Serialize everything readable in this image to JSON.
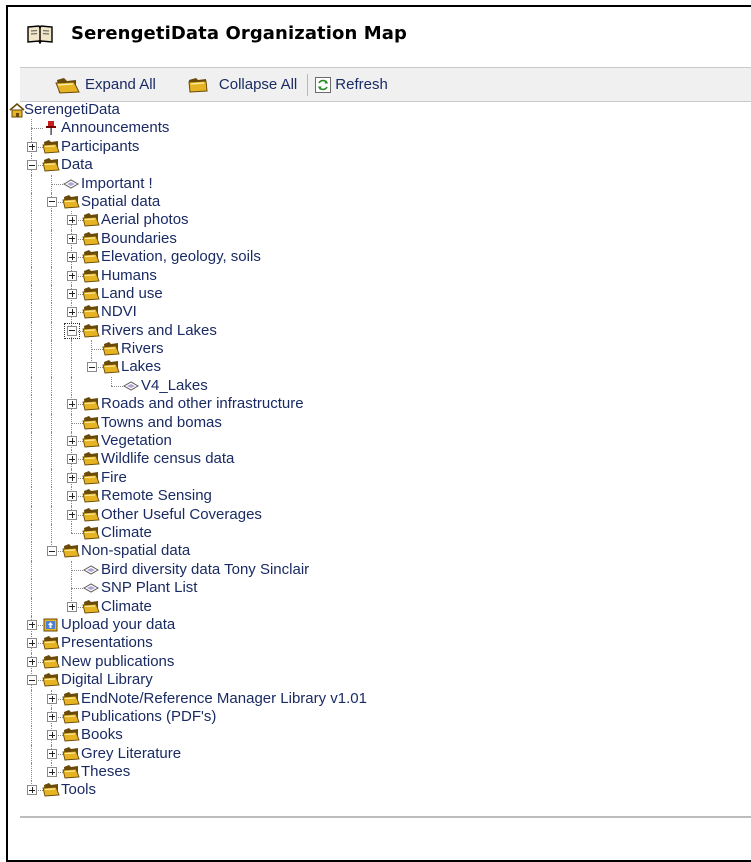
{
  "window": {
    "title": "SerengetiData Organization Map"
  },
  "toolbar": {
    "expand_all": "Expand All",
    "collapse_all": "Collapse All",
    "refresh": "Refresh"
  },
  "tree": [
    {
      "label": "SerengetiData",
      "depth": 0,
      "icon": "home",
      "state": "root"
    },
    {
      "label": "Announcements",
      "depth": 1,
      "icon": "pin",
      "state": "leaf"
    },
    {
      "label": "Participants",
      "depth": 1,
      "icon": "folder",
      "state": "collapsed"
    },
    {
      "label": "Data",
      "depth": 1,
      "icon": "folder",
      "state": "expanded"
    },
    {
      "label": "Important !",
      "depth": 2,
      "icon": "doc",
      "state": "leaf"
    },
    {
      "label": "Spatial data",
      "depth": 2,
      "icon": "folder",
      "state": "expanded"
    },
    {
      "label": "Aerial photos",
      "depth": 3,
      "icon": "folder",
      "state": "collapsed"
    },
    {
      "label": "Boundaries",
      "depth": 3,
      "icon": "folder",
      "state": "collapsed"
    },
    {
      "label": "Elevation, geology, soils",
      "depth": 3,
      "icon": "folder",
      "state": "collapsed"
    },
    {
      "label": "Humans",
      "depth": 3,
      "icon": "folder",
      "state": "collapsed"
    },
    {
      "label": "Land use",
      "depth": 3,
      "icon": "folder",
      "state": "collapsed"
    },
    {
      "label": "NDVI",
      "depth": 3,
      "icon": "folder",
      "state": "collapsed"
    },
    {
      "label": "Rivers and Lakes",
      "depth": 3,
      "icon": "folder",
      "state": "expanded",
      "focused": true
    },
    {
      "label": "Rivers",
      "depth": 4,
      "icon": "folder",
      "state": "leaf"
    },
    {
      "label": "Lakes",
      "depth": 4,
      "icon": "folder",
      "state": "expanded"
    },
    {
      "label": "V4_Lakes",
      "depth": 5,
      "icon": "doc",
      "state": "leaf"
    },
    {
      "label": "Roads and other infrastructure",
      "depth": 3,
      "icon": "folder",
      "state": "collapsed"
    },
    {
      "label": "Towns and bomas",
      "depth": 3,
      "icon": "folder",
      "state": "leaf"
    },
    {
      "label": "Vegetation",
      "depth": 3,
      "icon": "folder",
      "state": "collapsed"
    },
    {
      "label": "Wildlife census data",
      "depth": 3,
      "icon": "folder",
      "state": "collapsed"
    },
    {
      "label": "Fire",
      "depth": 3,
      "icon": "folder",
      "state": "collapsed"
    },
    {
      "label": "Remote Sensing",
      "depth": 3,
      "icon": "folder",
      "state": "collapsed"
    },
    {
      "label": "Other Useful Coverages",
      "depth": 3,
      "icon": "folder",
      "state": "collapsed"
    },
    {
      "label": "Climate",
      "depth": 3,
      "icon": "folder",
      "state": "leaf"
    },
    {
      "label": "Non-spatial data",
      "depth": 2,
      "icon": "folder",
      "state": "expanded"
    },
    {
      "label": "Bird diversity data Tony Sinclair",
      "depth": 3,
      "icon": "doc",
      "state": "leaf"
    },
    {
      "label": "SNP Plant List",
      "depth": 3,
      "icon": "doc",
      "state": "leaf"
    },
    {
      "label": "Climate",
      "depth": 3,
      "icon": "folder",
      "state": "collapsed"
    },
    {
      "label": "Upload your data",
      "depth": 1,
      "icon": "upload",
      "state": "collapsed"
    },
    {
      "label": "Presentations",
      "depth": 1,
      "icon": "folder",
      "state": "collapsed"
    },
    {
      "label": "New publications",
      "depth": 1,
      "icon": "folder",
      "state": "collapsed"
    },
    {
      "label": "Digital Library",
      "depth": 1,
      "icon": "folder",
      "state": "expanded"
    },
    {
      "label": "EndNote/Reference Manager Library v1.01",
      "depth": 2,
      "icon": "folder",
      "state": "collapsed"
    },
    {
      "label": "Publications (PDF's)",
      "depth": 2,
      "icon": "folder",
      "state": "collapsed"
    },
    {
      "label": "Books",
      "depth": 2,
      "icon": "folder",
      "state": "collapsed"
    },
    {
      "label": "Grey Literature",
      "depth": 2,
      "icon": "folder",
      "state": "collapsed"
    },
    {
      "label": "Theses",
      "depth": 2,
      "icon": "folder",
      "state": "collapsed"
    },
    {
      "label": "Tools",
      "depth": 1,
      "icon": "folder",
      "state": "collapsed"
    }
  ],
  "colors": {
    "link_text": "#1a2b63",
    "folder": "#e0b020",
    "toolbar_bg": "#f0f0f0"
  }
}
